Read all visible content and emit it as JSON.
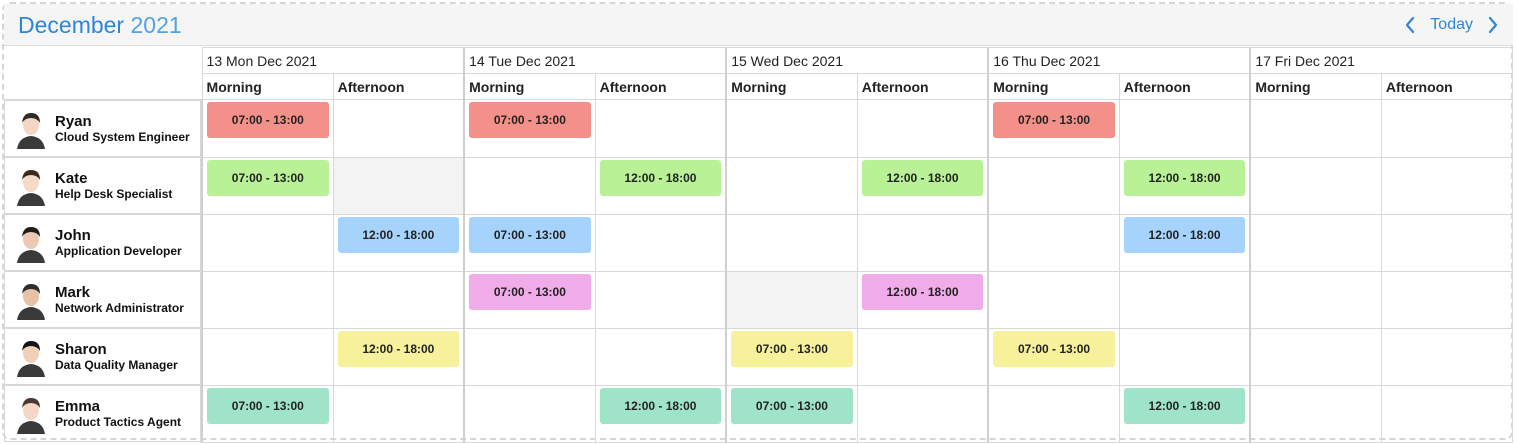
{
  "header": {
    "month": "December",
    "year": "2021",
    "today_label": "Today"
  },
  "days": [
    {
      "label": "13 Mon Dec 2021"
    },
    {
      "label": "14 Tue Dec 2021"
    },
    {
      "label": "15 Wed Dec 2021"
    },
    {
      "label": "16 Thu Dec 2021"
    },
    {
      "label": "17 Fri Dec 2021"
    }
  ],
  "slots": {
    "morning": "Morning",
    "afternoon": "Afternoon"
  },
  "colors": {
    "red": "#f4908a",
    "green": "#b9f196",
    "blue": "#a6d3fb",
    "pink": "#f0ace8",
    "yellow": "#f7f19c",
    "teal": "#9fe3c9",
    "blocked": "#f2f3f2"
  },
  "employees": [
    {
      "name": "Ryan",
      "role": "Cloud System Engineer",
      "cells": [
        {
          "text": "07:00 - 13:00",
          "color": "red"
        },
        null,
        {
          "text": "07:00 - 13:00",
          "color": "red"
        },
        null,
        null,
        null,
        {
          "text": "07:00 - 13:00",
          "color": "red"
        },
        null,
        null,
        null
      ]
    },
    {
      "name": "Kate",
      "role": "Help Desk Specialist",
      "cells": [
        {
          "text": "07:00 - 13:00",
          "color": "green"
        },
        {
          "blocked": true
        },
        null,
        {
          "text": "12:00 - 18:00",
          "color": "green"
        },
        null,
        {
          "text": "12:00 - 18:00",
          "color": "green"
        },
        null,
        {
          "text": "12:00 - 18:00",
          "color": "green"
        },
        null,
        null
      ]
    },
    {
      "name": "John",
      "role": "Application Developer",
      "cells": [
        null,
        {
          "text": "12:00 - 18:00",
          "color": "blue"
        },
        {
          "text": "07:00 - 13:00",
          "color": "blue"
        },
        null,
        null,
        null,
        null,
        {
          "text": "12:00 - 18:00",
          "color": "blue"
        },
        null,
        null
      ]
    },
    {
      "name": "Mark",
      "role": "Network Administrator",
      "cells": [
        null,
        null,
        {
          "text": "07:00 - 13:00",
          "color": "pink"
        },
        null,
        {
          "blocked": true
        },
        {
          "text": "12:00 - 18:00",
          "color": "pink"
        },
        null,
        null,
        null,
        null
      ]
    },
    {
      "name": "Sharon",
      "role": "Data Quality Manager",
      "cells": [
        null,
        {
          "text": "12:00 - 18:00",
          "color": "yellow"
        },
        null,
        null,
        {
          "text": "07:00 - 13:00",
          "color": "yellow"
        },
        null,
        {
          "text": "07:00 - 13:00",
          "color": "yellow"
        },
        null,
        null,
        null
      ]
    },
    {
      "name": "Emma",
      "role": "Product Tactics Agent",
      "cells": [
        {
          "text": "07:00 - 13:00",
          "color": "teal"
        },
        null,
        null,
        {
          "text": "12:00 - 18:00",
          "color": "teal"
        },
        {
          "text": "07:00 - 13:00",
          "color": "teal"
        },
        null,
        null,
        {
          "text": "12:00 - 18:00",
          "color": "teal"
        },
        null,
        null
      ]
    }
  ]
}
